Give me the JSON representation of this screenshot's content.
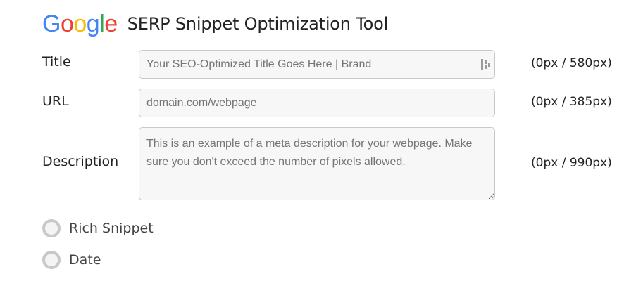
{
  "header": {
    "logo_letters": [
      {
        "char": "G",
        "color": "#4285F4"
      },
      {
        "char": "o",
        "color": "#EA4335"
      },
      {
        "char": "o",
        "color": "#FBBC05"
      },
      {
        "char": "g",
        "color": "#4285F4"
      },
      {
        "char": "l",
        "color": "#34A853"
      },
      {
        "char": "e",
        "color": "#EA4335"
      }
    ],
    "tool_title": "SERP Snippet Optimization Tool"
  },
  "form": {
    "title": {
      "label": "Title",
      "placeholder": "Your SEO-Optimized Title Goes Here | Brand",
      "counter": "(0px / 580px)",
      "icon": "password-manager-icon"
    },
    "url": {
      "label": "URL",
      "placeholder": "domain.com/webpage",
      "counter": "(0px / 385px)"
    },
    "description": {
      "label": "Description",
      "placeholder": "This is an example of a meta description for your webpage. Make sure you don't exceed the number of pixels allowed.",
      "counter": "(0px / 990px)"
    }
  },
  "options": {
    "rich_snippet_label": "Rich Snippet",
    "date_label": "Date"
  }
}
